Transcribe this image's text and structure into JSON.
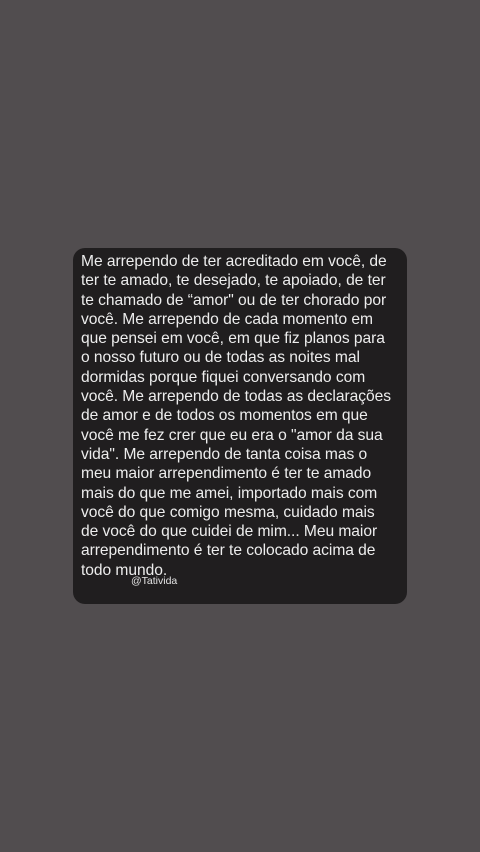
{
  "story": {
    "lines": [
      "Me arrependo de ter acreditado em você, de",
      "ter te amado, te desejado, te apoiado, de ter",
      "te chamado de “amor\" ou de ter chorado por",
      "você. Me arrependo de cada momento em",
      "que pensei em você, em que fiz planos para",
      "o nosso futuro ou de todas as noites mal",
      "dormidas porque fiquei conversando com",
      "você. Me arrependo de todas as declarações",
      "de amor e de todos os momentos em que",
      "você me fez crer que eu era o \"amor da sua",
      "vida\". Me arrependo de tanta coisa mas o",
      "meu maior arrependimento é ter te amado",
      "mais do que me amei, importado mais com",
      "você do que comigo mesma, cuidado mais",
      "de você do que cuidei de mim... Meu maior",
      "arrependimento é ter te colocado acima de",
      "todo mundo."
    ],
    "author": "@Tatividа"
  },
  "colors": {
    "background": "#514d4f",
    "card": "#201e1f",
    "text": "#ededed"
  }
}
